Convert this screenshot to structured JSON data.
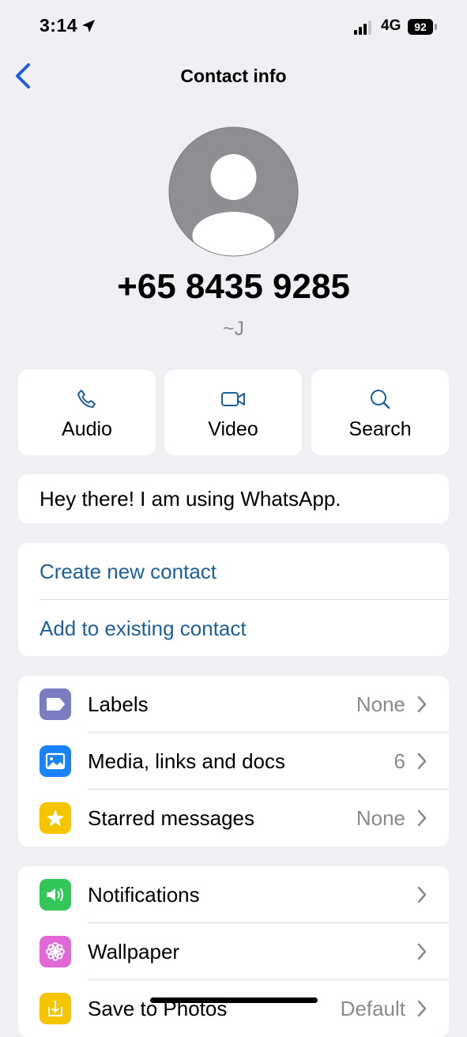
{
  "status_bar": {
    "time": "3:14",
    "network": "4G",
    "battery": "92"
  },
  "nav": {
    "title": "Contact info"
  },
  "contact": {
    "phone": "+65 8435 9285",
    "username": "~J"
  },
  "actions": [
    {
      "label": "Audio",
      "icon": "phone-icon"
    },
    {
      "label": "Video",
      "icon": "video-icon"
    },
    {
      "label": "Search",
      "icon": "search-icon"
    }
  ],
  "about": "Hey there! I am using WhatsApp.",
  "contact_actions": {
    "create": "Create new contact",
    "add_existing": "Add to existing contact"
  },
  "section1": [
    {
      "label": "Labels",
      "value": "None",
      "icon": "label-icon",
      "color": "#7b7dc2"
    },
    {
      "label": "Media, links and docs",
      "value": "6",
      "icon": "image-icon",
      "color": "#1a82f7"
    },
    {
      "label": "Starred messages",
      "value": "None",
      "icon": "star-icon",
      "color": "#f7c400"
    }
  ],
  "section2": [
    {
      "label": "Notifications",
      "value": "",
      "icon": "speaker-icon",
      "color": "#33c759"
    },
    {
      "label": "Wallpaper",
      "value": "",
      "icon": "flower-icon",
      "color": "#e069d7"
    },
    {
      "label": "Save to Photos",
      "value": "Default",
      "icon": "download-icon",
      "color": "#f7c400"
    }
  ],
  "colors": {
    "accent": "#1d5f9c",
    "background": "#efeff4"
  }
}
